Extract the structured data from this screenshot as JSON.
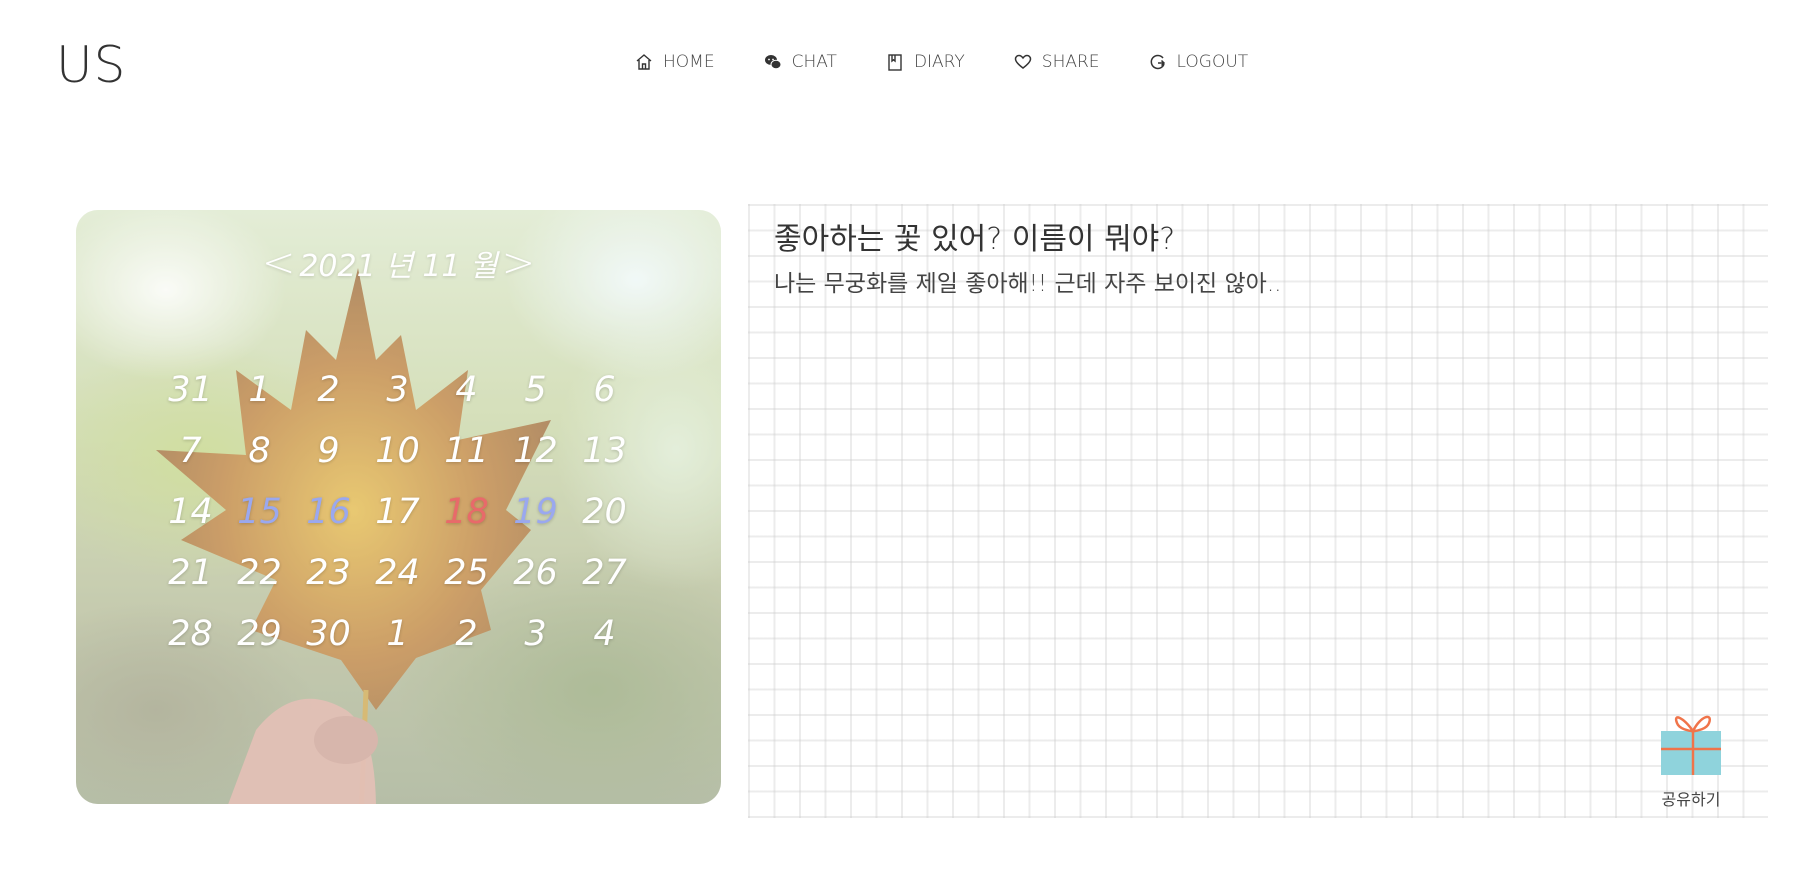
{
  "logo": "US",
  "nav": [
    {
      "label": "HOME",
      "icon": "home-icon"
    },
    {
      "label": "CHAT",
      "icon": "chat-icon"
    },
    {
      "label": "DIARY",
      "icon": "book-icon"
    },
    {
      "label": "SHARE",
      "icon": "heart-icon"
    },
    {
      "label": "LOGOUT",
      "icon": "logout-icon"
    }
  ],
  "calendar": {
    "title": "2021 년 11 월",
    "prev": "<",
    "next": ">",
    "days": [
      "31",
      "1",
      "2",
      "3",
      "4",
      "5",
      "6",
      "7",
      "8",
      "9",
      "10",
      "11",
      "12",
      "13",
      "14",
      "15",
      "16",
      "17",
      "18",
      "19",
      "20",
      "21",
      "22",
      "23",
      "24",
      "25",
      "26",
      "27",
      "28",
      "29",
      "30",
      "1",
      "2",
      "3",
      "4"
    ],
    "highlight_colors": {
      "15": "#9aa8ef",
      "16": "#9aa8ef",
      "18": "#e86a6a",
      "19": "#9aa8ef"
    }
  },
  "diary": {
    "question": "좋아하는 꽃 있어? 이름이 뭐야?",
    "answer": "나는 무궁화를 제일 좋아해!! 근데 자주 보이진 않아..",
    "share_label": "공유하기",
    "share_icon": "gift-icon"
  }
}
